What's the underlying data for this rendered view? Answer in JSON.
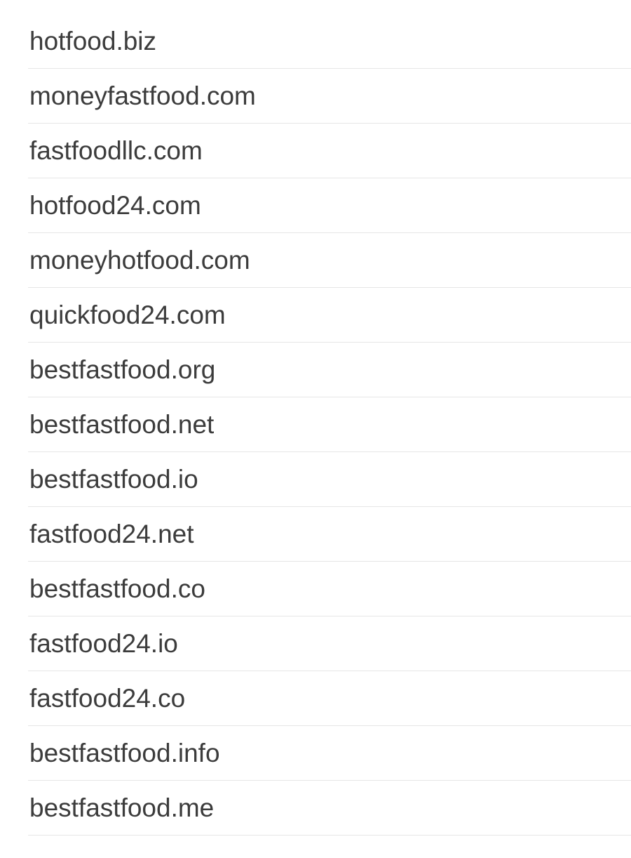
{
  "domains": [
    {
      "name": "hotfood.biz"
    },
    {
      "name": "moneyfastfood.com"
    },
    {
      "name": "fastfoodllc.com"
    },
    {
      "name": "hotfood24.com"
    },
    {
      "name": "moneyhotfood.com"
    },
    {
      "name": "quickfood24.com"
    },
    {
      "name": "bestfastfood.org"
    },
    {
      "name": "bestfastfood.net"
    },
    {
      "name": "bestfastfood.io"
    },
    {
      "name": "fastfood24.net"
    },
    {
      "name": "bestfastfood.co"
    },
    {
      "name": "fastfood24.io"
    },
    {
      "name": "fastfood24.co"
    },
    {
      "name": "bestfastfood.info"
    },
    {
      "name": "bestfastfood.me"
    }
  ]
}
